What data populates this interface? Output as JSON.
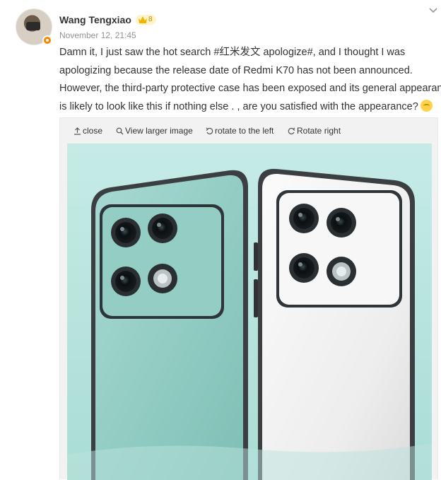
{
  "author": {
    "name": "Wang Tengxiao",
    "level": "8",
    "timestamp": "November 12, 21:45"
  },
  "post": {
    "lines": [
      "Damn it, I just saw the hot search #红米发文 apologize#, and I thought I was",
      "apologizing because the release date of Redmi K70 has not been announced.",
      "However, the third-party protective case has been exposed and its general appearance",
      "is likely to look like this if nothing else . , are you satisfied with the appearance?"
    ]
  },
  "media_toolbar": {
    "close": "close",
    "view_larger": "View larger image",
    "rotate_left": "rotate to the left",
    "rotate_right": "Rotate right"
  },
  "icons": [
    "avatar",
    "crown-icon",
    "chevron-down-icon",
    "smiley-emoji-icon",
    "upload-arrow-icon",
    "magnifier-icon",
    "rotate-left-icon",
    "rotate-right-icon"
  ],
  "colors": {
    "accent": "#ff8200",
    "text": "#333333",
    "muted": "#939393",
    "photo_teal": "#9fd3cc"
  }
}
